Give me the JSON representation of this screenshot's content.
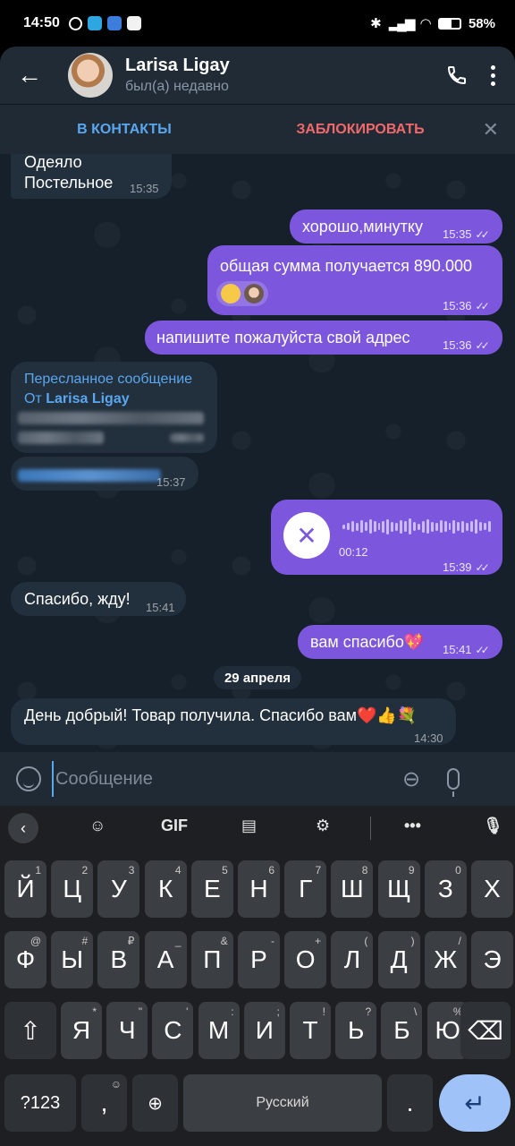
{
  "status_bar": {
    "time": "14:50",
    "battery": "58"
  },
  "header": {
    "name": "Larisa Ligay",
    "status": "был(а) недавно"
  },
  "actions": {
    "add_contact": "В КОНТАКТЫ",
    "block": "ЗАБЛОКИРОВАТЬ"
  },
  "messages": {
    "m1": {
      "line1": "Одеяло",
      "line2": "Постельное",
      "time": "15:35"
    },
    "m2": {
      "text": "хорошо,минутку",
      "time": "15:35"
    },
    "m3": {
      "text": "общая сумма получается 890.000",
      "time": "15:36"
    },
    "m4": {
      "text": "напишите пожалуйста свой адрес",
      "time": "15:36"
    },
    "m5": {
      "title": "Пересланное сообщение",
      "from_prefix": "От",
      "from_name": "Larisa Ligay"
    },
    "m6": {
      "time": "15:37"
    },
    "m7": {
      "duration": "00:12",
      "time": "15:39"
    },
    "m8": {
      "text": "Спасибо, жду!",
      "time": "15:41"
    },
    "m9": {
      "text": "вам спасибо💖",
      "time": "15:41"
    },
    "date": "29 апреля",
    "m10": {
      "text": "День добрый! Товар получила. Спасибо вам❤️👍💐",
      "time": "14:30"
    }
  },
  "composer": {
    "placeholder": "Сообщение"
  },
  "keyboard": {
    "toolbar": {
      "gif": "GIF"
    },
    "row1": [
      {
        "k": "Й",
        "s": "1"
      },
      {
        "k": "Ц",
        "s": "2"
      },
      {
        "k": "У",
        "s": "3"
      },
      {
        "k": "К",
        "s": "4"
      },
      {
        "k": "Е",
        "s": "5"
      },
      {
        "k": "Н",
        "s": "6"
      },
      {
        "k": "Г",
        "s": "7"
      },
      {
        "k": "Ш",
        "s": "8"
      },
      {
        "k": "Щ",
        "s": "9"
      },
      {
        "k": "З",
        "s": "0"
      },
      {
        "k": "Х",
        "s": ""
      }
    ],
    "row2": [
      {
        "k": "Ф",
        "s": "@"
      },
      {
        "k": "Ы",
        "s": "#"
      },
      {
        "k": "В",
        "s": "₽"
      },
      {
        "k": "А",
        "s": "_"
      },
      {
        "k": "П",
        "s": "&"
      },
      {
        "k": "Р",
        "s": "-"
      },
      {
        "k": "О",
        "s": "+"
      },
      {
        "k": "Л",
        "s": "("
      },
      {
        "k": "Д",
        "s": ")"
      },
      {
        "k": "Ж",
        "s": "/"
      },
      {
        "k": "Э",
        "s": ""
      }
    ],
    "row3": [
      {
        "k": "Я",
        "s": "*"
      },
      {
        "k": "Ч",
        "s": "\""
      },
      {
        "k": "С",
        "s": "'"
      },
      {
        "k": "М",
        "s": ":"
      },
      {
        "k": "И",
        "s": ";"
      },
      {
        "k": "Т",
        "s": "!"
      },
      {
        "k": "Ь",
        "s": "?"
      },
      {
        "k": "Б",
        "s": "\\"
      },
      {
        "k": "Ю",
        "s": "%"
      }
    ],
    "sym_label": "?123",
    "comma": ",",
    "space_label": "Русский",
    "period": "."
  }
}
